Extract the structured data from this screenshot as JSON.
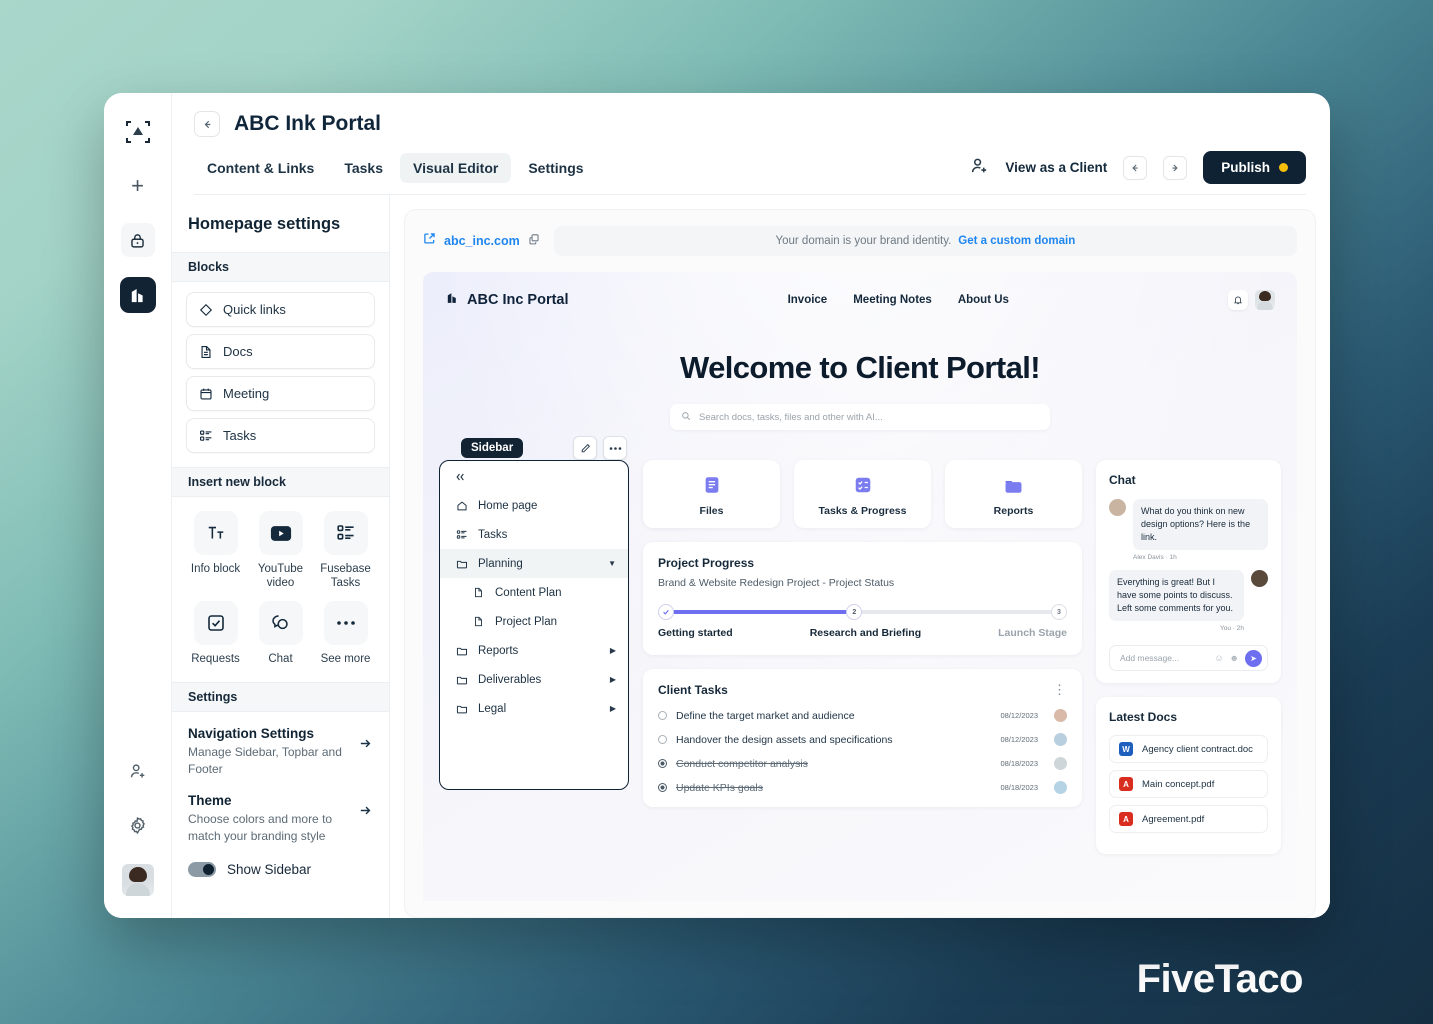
{
  "brand": {
    "watermark": "FiveTaco"
  },
  "rail": {
    "logo_icon": "app-logo-icon",
    "add_icon": "plus-icon",
    "lock_icon": "lock-icon",
    "portal_icon": "portal-building-icon",
    "invite_icon": "add-user-icon",
    "settings_icon": "gear-icon",
    "avatar_icon": "user-avatar"
  },
  "header": {
    "back_icon": "arrow-left-icon",
    "title": "ABC Ink Portal",
    "tabs": [
      {
        "label": "Content & Links",
        "active": false
      },
      {
        "label": "Tasks",
        "active": false
      },
      {
        "label": "Visual Editor",
        "active": true
      },
      {
        "label": "Settings",
        "active": false
      }
    ],
    "invite_icon": "add-user-icon",
    "view_as_client": "View as a Client",
    "undo_icon": "arrow-left-icon",
    "redo_icon": "arrow-right-icon",
    "publish_label": "Publish",
    "publish_dot_color": "#f5bf0a",
    "publish_bg": "#0f2233"
  },
  "sidebar_settings": {
    "title": "Homepage settings",
    "blocks_header": "Blocks",
    "blocks": [
      {
        "label": "Quick links",
        "icon": "diamond-icon"
      },
      {
        "label": "Docs",
        "icon": "document-icon"
      },
      {
        "label": "Meeting",
        "icon": "calendar-icon"
      },
      {
        "label": "Tasks",
        "icon": "task-list-icon"
      }
    ],
    "insert_header": "Insert new block",
    "insert_blocks": [
      {
        "label": "Info block",
        "icon": "text-format-icon"
      },
      {
        "label": "YouTube video",
        "icon": "youtube-icon"
      },
      {
        "label": "Fusebase Tasks",
        "icon": "task-list-icon"
      },
      {
        "label": "Requests",
        "icon": "checkbox-icon"
      },
      {
        "label": "Chat",
        "icon": "chat-icon"
      },
      {
        "label": "See more",
        "icon": "ellipsis-icon"
      }
    ],
    "settings_header": "Settings",
    "settings_rows": [
      {
        "title": "Navigation Settings",
        "desc": "Manage Sidebar, Topbar and Footer"
      },
      {
        "title": "Theme",
        "desc": "Choose colors and more to match your branding style"
      }
    ],
    "toggle_label": "Show Sidebar",
    "toggle_on": true
  },
  "preview": {
    "domain": {
      "external_icon": "external-link-icon",
      "link": "abc_inc.com",
      "copy_icon": "copy-icon",
      "banner_text": "Your domain is your brand identity.",
      "banner_action": "Get a custom domain"
    },
    "portal_nav": {
      "brand_icon": "portal-building-icon",
      "brand": "ABC Inc Portal",
      "links": [
        "Invoice",
        "Meeting Notes",
        "About Us"
      ],
      "bell_icon": "bell-icon",
      "avatar": "user-avatar"
    },
    "hero": {
      "heading": "Welcome to Client Portal!",
      "search_icon": "search-icon",
      "search_placeholder": "Search docs, tasks, files and other with AI..."
    },
    "sidebar_block": {
      "badge": "Sidebar",
      "edit_icon": "pencil-icon",
      "more_icon": "ellipsis-icon",
      "collapse_icon": "chevrons-left-icon",
      "items": [
        {
          "label": "Home page",
          "icon": "home-icon",
          "type": "item"
        },
        {
          "label": "Tasks",
          "icon": "task-list-icon",
          "type": "item"
        },
        {
          "label": "Planning",
          "icon": "folder-icon",
          "type": "folder",
          "expanded": true,
          "active": true
        },
        {
          "label": "Content Plan",
          "icon": "document-icon",
          "type": "sub"
        },
        {
          "label": "Project Plan",
          "icon": "document-icon",
          "type": "sub"
        },
        {
          "label": "Reports",
          "icon": "folder-icon",
          "type": "folder",
          "expanded": false
        },
        {
          "label": "Deliverables",
          "icon": "folder-icon",
          "type": "folder",
          "expanded": false
        },
        {
          "label": "Legal",
          "icon": "folder-icon",
          "type": "folder",
          "expanded": false
        }
      ]
    },
    "quick_links": [
      {
        "label": "Files",
        "icon": "file-lines-icon",
        "color": "#7b7cf0"
      },
      {
        "label": "Tasks & Progress",
        "icon": "task-check-icon",
        "color": "#7b7cf0"
      },
      {
        "label": "Reports",
        "icon": "folder-icon",
        "color": "#7b7cf0"
      }
    ],
    "progress": {
      "title": "Project Progress",
      "subtitle": "Brand & Website Redesign Project - Project Status",
      "accent": "#6d6ef0",
      "steps": [
        {
          "marker": "check",
          "label": "Getting started",
          "state": "done"
        },
        {
          "marker": "2",
          "label": "Research and Briefing",
          "state": "current"
        },
        {
          "marker": "3",
          "label": "Launch Stage",
          "state": "upcoming"
        }
      ]
    },
    "client_tasks": {
      "title": "Client Tasks",
      "menu_icon": "vertical-dots-icon",
      "rows": [
        {
          "text": "Define the target market and audience",
          "done": false,
          "date": "08/12/2023",
          "avatar_color": "#d9b9a8"
        },
        {
          "text": "Handover the design assets and specifications",
          "done": false,
          "date": "08/12/2023",
          "avatar_color": "#b8cfe0"
        },
        {
          "text": "Conduct competitor analysis",
          "done": true,
          "date": "08/18/2023",
          "avatar_color": "#cfd6da"
        },
        {
          "text": "Update KPIs goals",
          "done": true,
          "date": "08/18/2023",
          "avatar_color": "#b6d3e6"
        }
      ]
    },
    "chat": {
      "title": "Chat",
      "messages": [
        {
          "dir": "in",
          "text": "What do you think on new design options? Here is the link.",
          "link_word": "link",
          "meta": "Alex Davis · 1h",
          "avatar_color": "#c9b4a2"
        },
        {
          "dir": "out",
          "text": "Everything is great! But I have some points to discuss. Left some comments for you.",
          "meta": "You · 2h",
          "avatar_color": "#5a4a3c"
        }
      ],
      "input_placeholder": "Add message...",
      "emoji_icon": "emoji-icon",
      "attach_icon": "attachment-icon",
      "send_icon": "send-icon",
      "send_color": "#6d6ef0"
    },
    "latest_docs": {
      "title": "Latest Docs",
      "rows": [
        {
          "name": "Agency client contract.doc",
          "kind": "word",
          "color": "#1e5fbe",
          "glyph": "W"
        },
        {
          "name": "Main concept.pdf",
          "kind": "pdf",
          "color": "#d92d20",
          "glyph": "A"
        },
        {
          "name": "Agreement.pdf",
          "kind": "pdf",
          "color": "#d92d20",
          "glyph": "A"
        }
      ]
    }
  }
}
